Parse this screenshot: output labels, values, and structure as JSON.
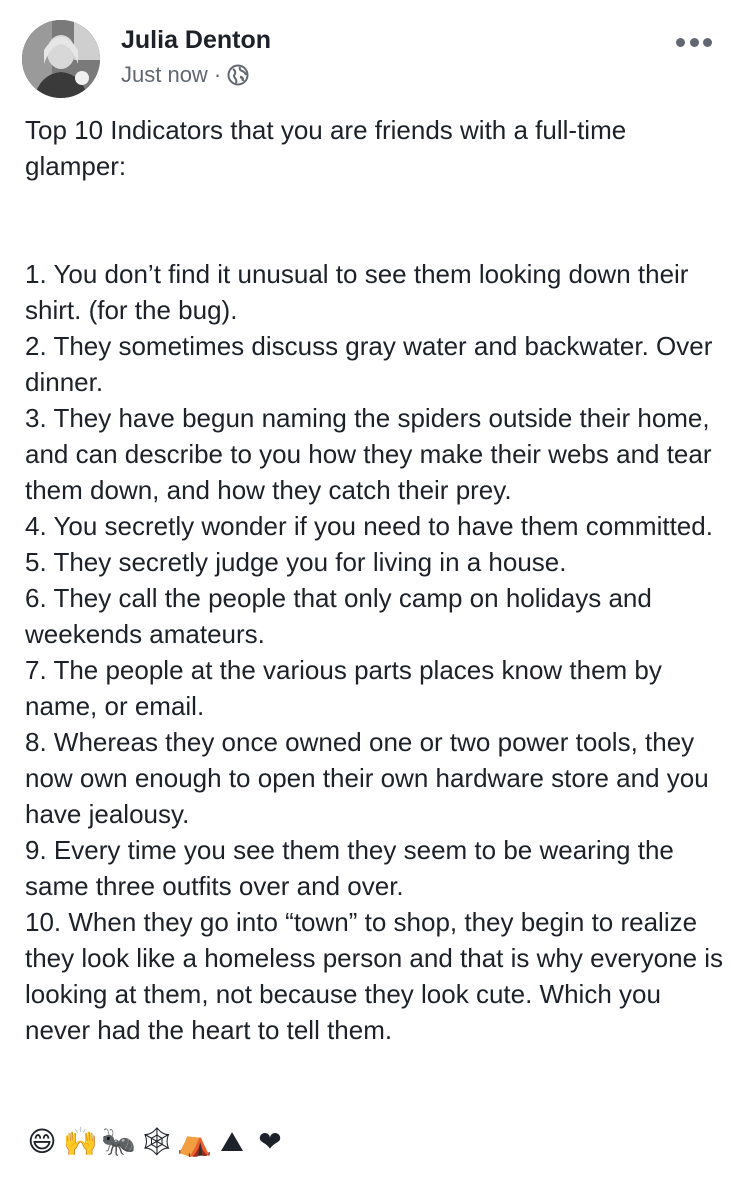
{
  "post": {
    "author": "Julia Denton",
    "time": "Just now",
    "separator": "·",
    "privacy_icon": "globe-icon",
    "more_icon": "more-options-icon",
    "intro_line1": "Top 10 Indicators that you are friends with a full-time",
    "intro_line2": "glamper:",
    "items": [
      "1. You don’t find it unusual to see them looking down their shirt. (for the bug).",
      "2. They sometimes discuss gray water and backwater. Over dinner.",
      "3. They have begun naming the spiders outside their home, and can describe to you how they make their webs and tear them down, and how they catch their prey.",
      "4. You secretly wonder if you need to have them committed.",
      "5. They secretly judge you for living in a house.",
      "6. They call the people that only camp on holidays and weekends amateurs.",
      "7. The people at the various parts places know them by name, or email.",
      "8. Whereas they once owned one or two power tools, they now own enough to open their own hardware store and you have jealousy.",
      "9. Every time you see them they seem to be wearing the same three outfits over and over.",
      "10. When they go into “town” to shop, they begin to realize they look like a homeless person and that is why everyone is looking at them, not because they look cute. Which you never had the heart to tell them."
    ],
    "emojis": [
      {
        "name": "grinning-face-icon",
        "glyph": "😄"
      },
      {
        "name": "raised-hands-icon",
        "glyph": "🙌"
      },
      {
        "name": "ant-icon",
        "glyph": "🐜"
      },
      {
        "name": "spider-web-icon",
        "glyph": "🕸"
      },
      {
        "name": "tent-icon",
        "glyph": "⛺"
      },
      {
        "name": "mountain-icon",
        "glyph": "⛰"
      },
      {
        "name": "red-heart-icon",
        "glyph": "❤"
      }
    ]
  }
}
